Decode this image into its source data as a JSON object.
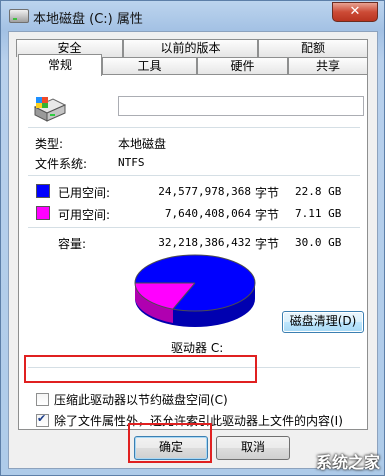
{
  "window": {
    "title": "本地磁盘 (C:) 属性",
    "close_label": "✕"
  },
  "tabs_row1": [
    {
      "label": "安全"
    },
    {
      "label": "以前的版本"
    },
    {
      "label": "配额"
    }
  ],
  "tabs_row2": [
    {
      "label": "常规",
      "active": true
    },
    {
      "label": "工具"
    },
    {
      "label": "硬件"
    },
    {
      "label": "共享"
    }
  ],
  "general": {
    "drive_name_value": "",
    "type_label": "类型:",
    "type_value": "本地磁盘",
    "fs_label": "文件系统:",
    "fs_value": "NTFS",
    "used": {
      "label": "已用空间:",
      "bytes": "24,577,978,368",
      "unit": "字节",
      "size": "22.8 GB",
      "color": "#0000ff"
    },
    "free": {
      "label": "可用空间:",
      "bytes": "7,640,408,064",
      "unit": "字节",
      "size": "7.11 GB",
      "color": "#ff00ff"
    },
    "capacity": {
      "label": "容量:",
      "bytes": "32,218,386,432",
      "unit": "字节",
      "size": "30.0 GB"
    },
    "drive_label": "驱动器 C:",
    "cleanup_button": "磁盘清理(D)",
    "compress_label": "压缩此驱动器以节约磁盘空间(C)",
    "compress_checked": false,
    "index_label": "除了文件属性外，还允许索引此驱动器上文件的内容(I)",
    "index_checked": true
  },
  "footer": {
    "ok": "确定",
    "cancel": "取消"
  },
  "watermark": "系统之家"
}
